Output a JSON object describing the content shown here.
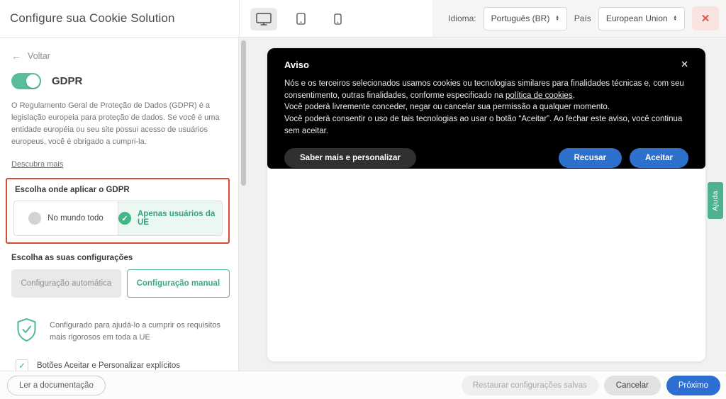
{
  "header": {
    "title": "Configure sua Cookie Solution",
    "language_label": "Idioma:",
    "language_value": "Português (BR)",
    "country_label": "País",
    "country_value": "European Union",
    "close_icon": "✕"
  },
  "sidebar": {
    "back_label": "Voltar",
    "back_arrow": "←",
    "gdpr_label": "GDPR",
    "gdpr_description": "O Regulamento Geral de Proteção de Dados (GDPR) é a legislação europeia para proteção de dados. Se você é uma entidade européia ou seu site possui acesso de usuários europeus, você é obrigado a cumpri-la.",
    "discover_more": "Descubra mais",
    "where_heading": "Escolha onde aplicar o GDPR",
    "option_worldwide": "No mundo todo",
    "option_eu_only": "Apenas usuários da UE",
    "option_eu_check": "✓",
    "config_heading": "Escolha as suas configurações",
    "config_auto": "Configuração automática",
    "config_manual": "Configuração manual",
    "shield_text": "Configurado para ajudá-lo a cumprir os requisitos mais rigorosos em toda a UE",
    "checkbox_label": "Botões Aceitar e Personalizar explícitos",
    "checkbox_check": "✓"
  },
  "banner": {
    "title": "Aviso",
    "close_icon": "✕",
    "body_before_link": "Nós e os terceiros selecionados usamos cookies ou tecnologias similares para finalidades técnicas e, com seu consentimento, outras finalidades, conforme especificado na ",
    "policy_link": "política de cookies",
    "body_after_link": ".",
    "body_line2": "Você poderá livremente conceder, negar ou cancelar sua permissão a qualquer momento.",
    "body_line3": "Você poderá consentir o uso de tais tecnologias ao usar o botão “Aceitar”. Ao fechar este aviso, você continua sem aceitar.",
    "customize_button": "Saber mais e personalizar",
    "reject_button": "Recusar",
    "accept_button": "Aceitar"
  },
  "help_tab": {
    "label": "Ajuda"
  },
  "footer": {
    "docs_button": "Ler a documentação",
    "restore_button": "Restaurar configurações salvas",
    "cancel_button": "Cancelar",
    "next_button": "Próximo"
  },
  "colors": {
    "accent_green": "#4eb291",
    "toggle_green": "#58bd99",
    "selected_green_bg": "#ebf7f1",
    "primary_blue": "#2d71cd",
    "alert_red_border": "#d84a31",
    "close_red": "#d9584b",
    "banner_bg": "#000000"
  }
}
